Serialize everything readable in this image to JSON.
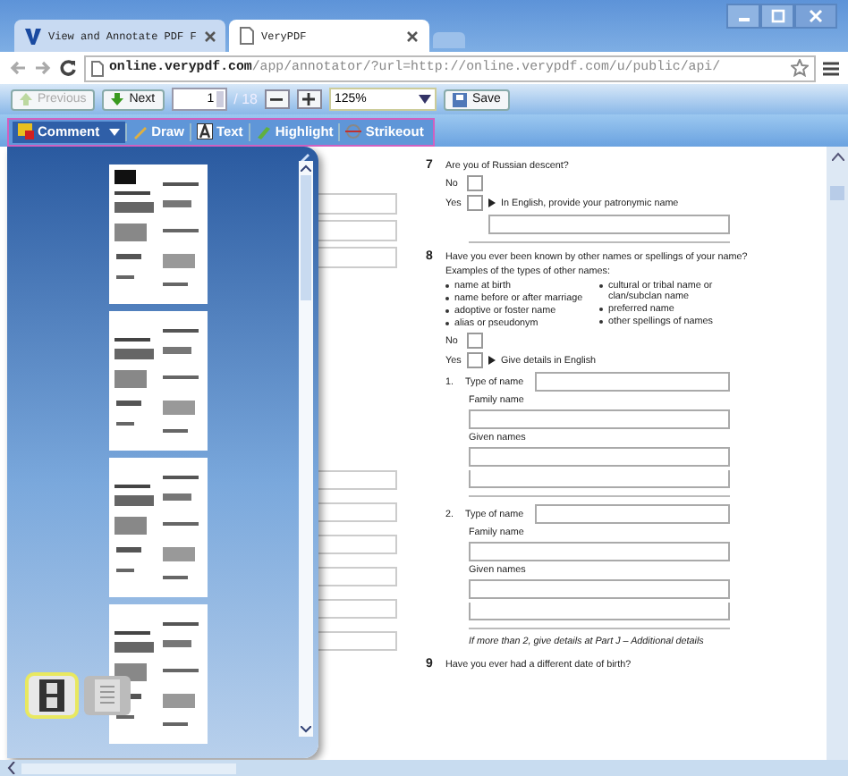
{
  "tabs": [
    {
      "title": "View and Annotate PDF F",
      "selected": false
    },
    {
      "title": "VeryPDF",
      "selected": true
    }
  ],
  "address": {
    "host": "online.verypdf.com",
    "path": "/app/annotator/?url=http://online.verypdf.com/u/public/api/"
  },
  "navigation": {
    "previous": {
      "label": "Previous",
      "disabled": true
    },
    "next": {
      "label": "Next",
      "disabled": false
    },
    "page": "1",
    "total": "/ 18",
    "zoom": "125%",
    "save": "Save"
  },
  "annotation_tools": [
    {
      "label": "Comment",
      "kind": "comment",
      "selected": true,
      "dropdown": true
    },
    {
      "label": "Draw",
      "kind": "draw",
      "selected": false,
      "dropdown": false
    },
    {
      "label": "Text",
      "kind": "text",
      "selected": false,
      "dropdown": false
    },
    {
      "label": "Highlight",
      "kind": "highlight",
      "selected": false,
      "dropdown": false
    },
    {
      "label": "Strikeout",
      "kind": "strikeout",
      "selected": false,
      "dropdown": false
    }
  ],
  "thumbnail_panel": {
    "view_buttons": [
      {
        "kind": "filmstrip",
        "selected": true
      },
      {
        "kind": "list",
        "selected": false
      }
    ]
  },
  "document": {
    "q7": {
      "number": "7",
      "question": "Are you of Russian descent?",
      "options": [
        {
          "label": "No",
          "checked": false
        },
        {
          "label": "Yes",
          "checked": false,
          "note": "In English, provide your patronymic name"
        }
      ]
    },
    "q8": {
      "number": "8",
      "question": "Have you ever been known by other names or spellings of your name?",
      "examples_title": "Examples of the types of other names:",
      "examples_left": [
        "name at birth",
        "name before or after marriage",
        "adoptive or foster name",
        "alias or pseudonym"
      ],
      "examples_right": [
        "cultural or tribal name or clan/subclan name",
        "preferred name",
        "other spellings of names"
      ],
      "options": [
        {
          "label": "No",
          "checked": false
        },
        {
          "label": "Yes",
          "checked": false,
          "note": "Give details in English"
        }
      ],
      "entries": [
        {
          "number": "1.",
          "type_label": "Type of name",
          "family_label": "Family name",
          "given_label": "Given names"
        },
        {
          "number": "2.",
          "type_label": "Type of name",
          "family_label": "Family name",
          "given_label": "Given names"
        }
      ],
      "footnote": "*If more than 2, give details at Part J – Additional details*"
    },
    "q9": {
      "number": "9",
      "question": "Have you ever had a different date of birth?"
    }
  }
}
